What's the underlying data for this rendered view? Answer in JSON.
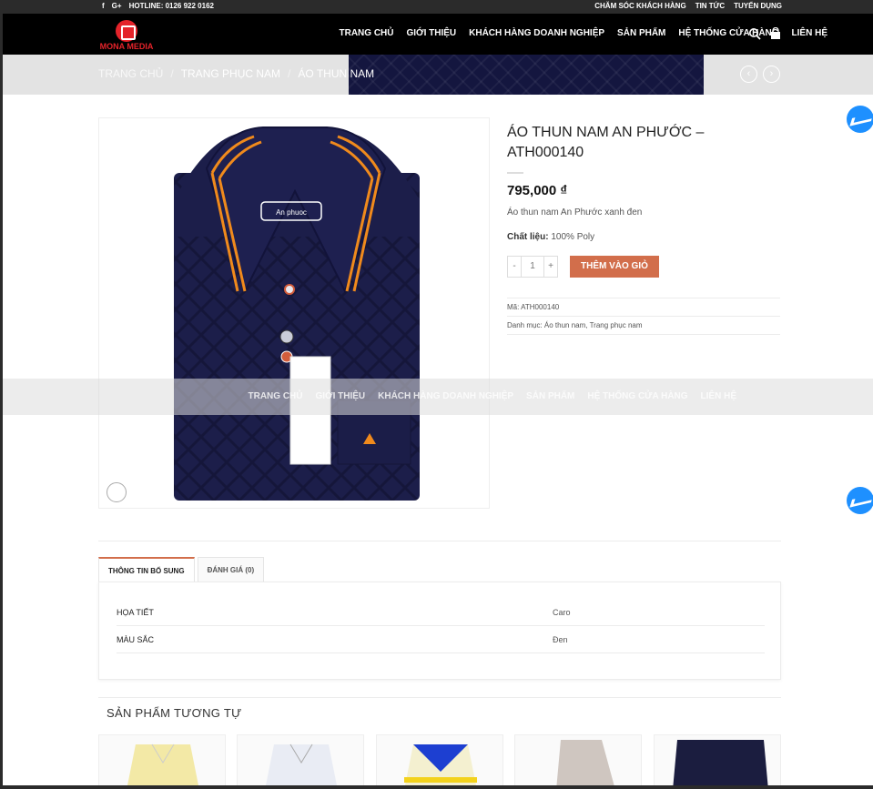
{
  "topbar": {
    "hotline": "HOTLINE: 0126 922 0162",
    "links": [
      "CHĂM SÓC KHÁCH HÀNG",
      "TIN TỨC",
      "TUYỂN DỤNG"
    ],
    "social_icons": [
      "facebook-icon",
      "google-plus-icon"
    ]
  },
  "header": {
    "logo_text": "MONA MEDIA",
    "nav": [
      "TRANG CHỦ",
      "GIỚI THIỆU",
      "KHÁCH HÀNG DOANH NGHIỆP",
      "SẢN PHẨM",
      "HỆ THỐNG CỬA HÀNG",
      "LIÊN HỆ"
    ],
    "icons": [
      "search-icon",
      "cart-icon"
    ]
  },
  "breadcrumb": {
    "items": [
      "TRANG CHỦ",
      "TRANG PHỤC NAM",
      "ÁO THUN NAM"
    ],
    "separator": "/"
  },
  "product": {
    "title": "ÁO THUN NAM AN PHƯỚC – ATH000140",
    "price": "795,000 ₫",
    "short_desc": "Áo thun nam An Phước xanh đen",
    "material_label": "Chất liệu:",
    "material_value": "100% Poly",
    "qty_minus": "-",
    "qty_value": "1",
    "qty_plus": "+",
    "add_to_cart": "THÊM VÀO GIỎ",
    "sku": "Mã: ATH000140",
    "categories": "Danh mục: Áo thun nam, Trang phục nam",
    "tag_brand": "An phuoc",
    "accent_color": "#d26e4b"
  },
  "tabs": [
    {
      "label": "THÔNG TIN BỔ SUNG",
      "active": true
    },
    {
      "label": "ĐÁNH GIÁ (0)",
      "active": false
    }
  ],
  "attributes": [
    {
      "key": "HỌA TIẾT",
      "value": "Caro"
    },
    {
      "key": "MÀU SẮC",
      "value": "Đen"
    }
  ],
  "related": {
    "title": "SẢN PHẨM TƯƠNG TỰ",
    "items": [
      {
        "color": "#f3e9a6"
      },
      {
        "color": "#e9ecf4"
      },
      {
        "color": "#1d3fd1"
      },
      {
        "color": "#cfc6c0"
      },
      {
        "color": "#1b1d3f"
      }
    ]
  }
}
